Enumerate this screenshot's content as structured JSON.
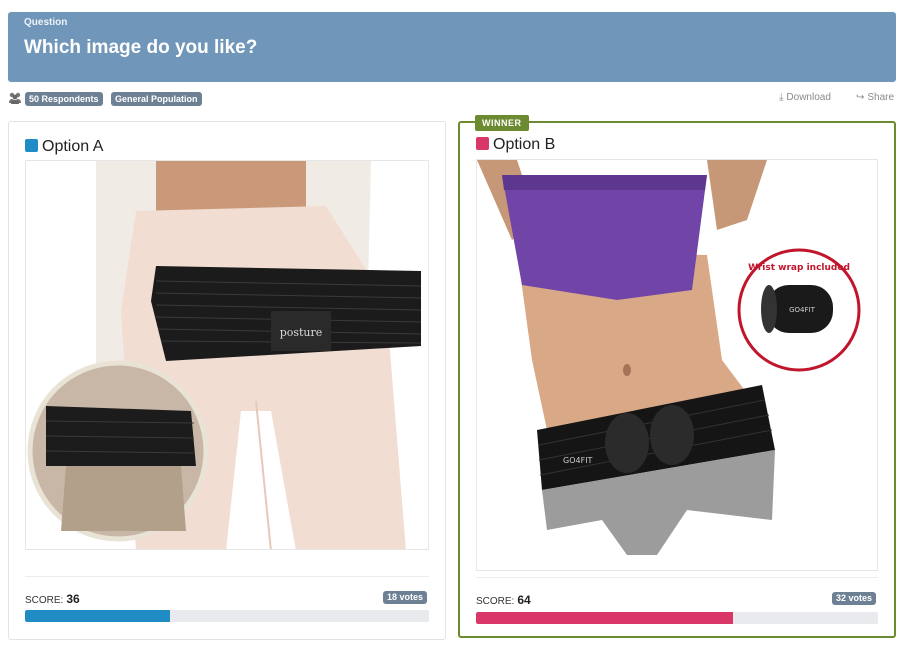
{
  "question": {
    "label": "Question",
    "title": "Which image do you like?"
  },
  "meta": {
    "respondents": "50 Respondents",
    "population": "General Population",
    "download": "Download",
    "share": "Share",
    "icons": {
      "people": "people-icon",
      "download": "download-icon",
      "share": "share-icon"
    }
  },
  "winner_label": "WINNER",
  "options": [
    {
      "title": "Option A",
      "color": "#1f8cc6",
      "score_label": "SCORE:",
      "score": "36",
      "votes": "18 votes",
      "bar_fraction": 0.36,
      "image_text": "posture"
    },
    {
      "title": "Option B",
      "color": "#d83768",
      "score_label": "SCORE:",
      "score": "64",
      "votes": "32 votes",
      "bar_fraction": 0.64,
      "image_text": "GO4FIT",
      "badge_text": "Wrist wrap included",
      "wrap_text": "GO4FIT"
    }
  ]
}
